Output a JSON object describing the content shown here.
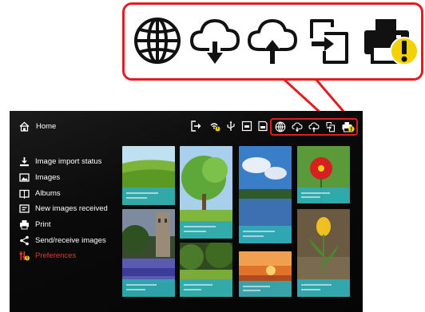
{
  "callout": {
    "icons": [
      "globe-icon",
      "cloud-download-icon",
      "cloud-upload-icon",
      "copy-import-icon",
      "printer-warning-icon"
    ],
    "border_color": "#e11d22"
  },
  "screen": {
    "home_label": "Home",
    "menu": [
      {
        "label": "Image import status",
        "icon": "download-icon"
      },
      {
        "label": "Images",
        "icon": "images-icon"
      },
      {
        "label": "Albums",
        "icon": "albums-icon"
      },
      {
        "label": "New images received",
        "icon": "new-images-icon"
      },
      {
        "label": "Print",
        "icon": "printer-icon"
      },
      {
        "label": "Send/receive images",
        "icon": "share-icon"
      },
      {
        "label": "Preferences",
        "icon": "preferences-warning-icon"
      }
    ],
    "active_menu_color": "#e8352b",
    "toolbar_icons": [
      "logout-icon",
      "wifi-warning-icon",
      "usb-icon",
      "card-icon",
      "sd-card-icon",
      "globe-icon",
      "cloud-download-icon",
      "cloud-upload-icon",
      "copy-import-icon",
      "printer-warning-icon"
    ]
  }
}
